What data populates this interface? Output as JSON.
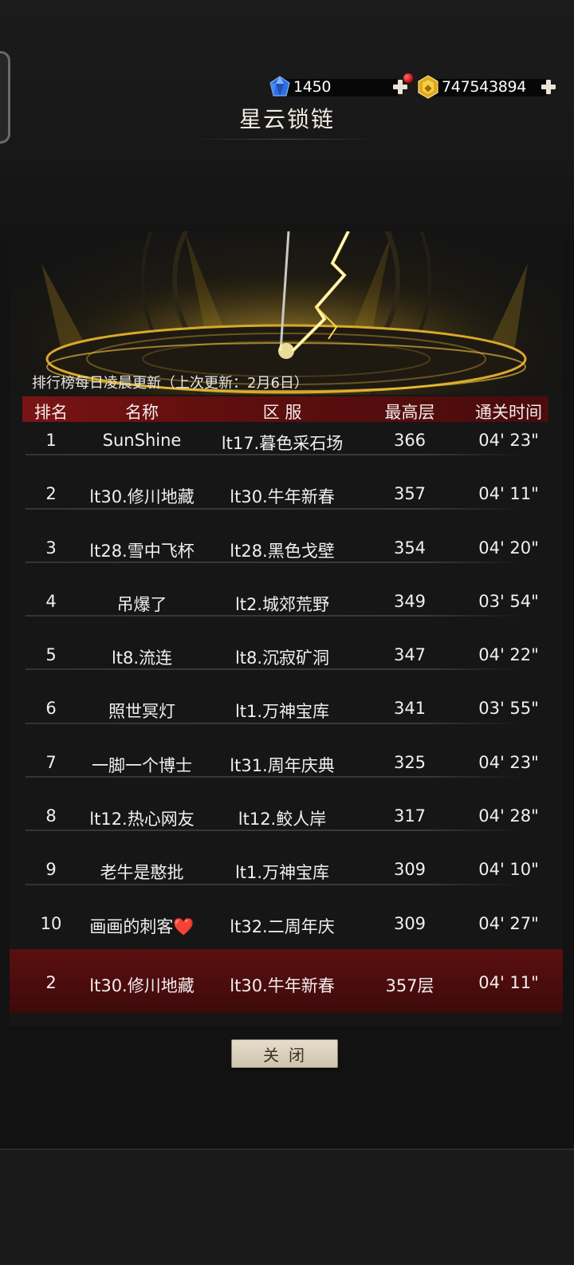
{
  "currency": {
    "gems": "1450",
    "gold": "747543894"
  },
  "title": "星云锁链",
  "update_note": "排行榜每日凌晨更新（上次更新：2月6日）",
  "table": {
    "headers": [
      "排名",
      "名称",
      "区 服",
      "最高层",
      "通关时间"
    ],
    "rows": [
      {
        "rank": "1",
        "name": "SunShine",
        "server": "lt17.暮色采石场",
        "floor": "366",
        "time": "04' 23\""
      },
      {
        "rank": "2",
        "name": "lt30.修川地藏",
        "server": "lt30.牛年新春",
        "floor": "357",
        "time": "04' 11\""
      },
      {
        "rank": "3",
        "name": "lt28.雪中飞杯",
        "server": "lt28.黑色戈壁",
        "floor": "354",
        "time": "04' 20\""
      },
      {
        "rank": "4",
        "name": "吊爆了",
        "server": "lt2.城郊荒野",
        "floor": "349",
        "time": "03' 54\""
      },
      {
        "rank": "5",
        "name": "lt8.流连",
        "server": "lt8.沉寂矿洞",
        "floor": "347",
        "time": "04' 22\""
      },
      {
        "rank": "6",
        "name": "照世冥灯",
        "server": "lt1.万神宝库",
        "floor": "341",
        "time": "03' 55\""
      },
      {
        "rank": "7",
        "name": "一脚一个博士",
        "server": "lt31.周年庆典",
        "floor": "325",
        "time": "04' 23\""
      },
      {
        "rank": "8",
        "name": "lt12.热心网友",
        "server": "lt12.鲛人岸",
        "floor": "317",
        "time": "04' 28\""
      },
      {
        "rank": "9",
        "name": "老牛是憨批",
        "server": "lt1.万神宝库",
        "floor": "309",
        "time": "04' 10\""
      },
      {
        "rank": "10",
        "name": "画画的刺客❤️",
        "server": "lt32.二周年庆",
        "floor": "309",
        "time": "04' 27\""
      }
    ]
  },
  "self_row": {
    "rank": "2",
    "name": "lt30.修川地藏",
    "server": "lt30.牛年新春",
    "floor": "357层",
    "time": "04' 11\""
  },
  "close_label": "关闭",
  "colors": {
    "header_red": "#7a1414",
    "self_row_red": "#4a0c0d",
    "lightning": "#ffd84a",
    "background": "#121212"
  },
  "icons": [
    "blue-gem-icon",
    "gold-coin-icon",
    "plus-icon",
    "notification-dot-icon"
  ]
}
